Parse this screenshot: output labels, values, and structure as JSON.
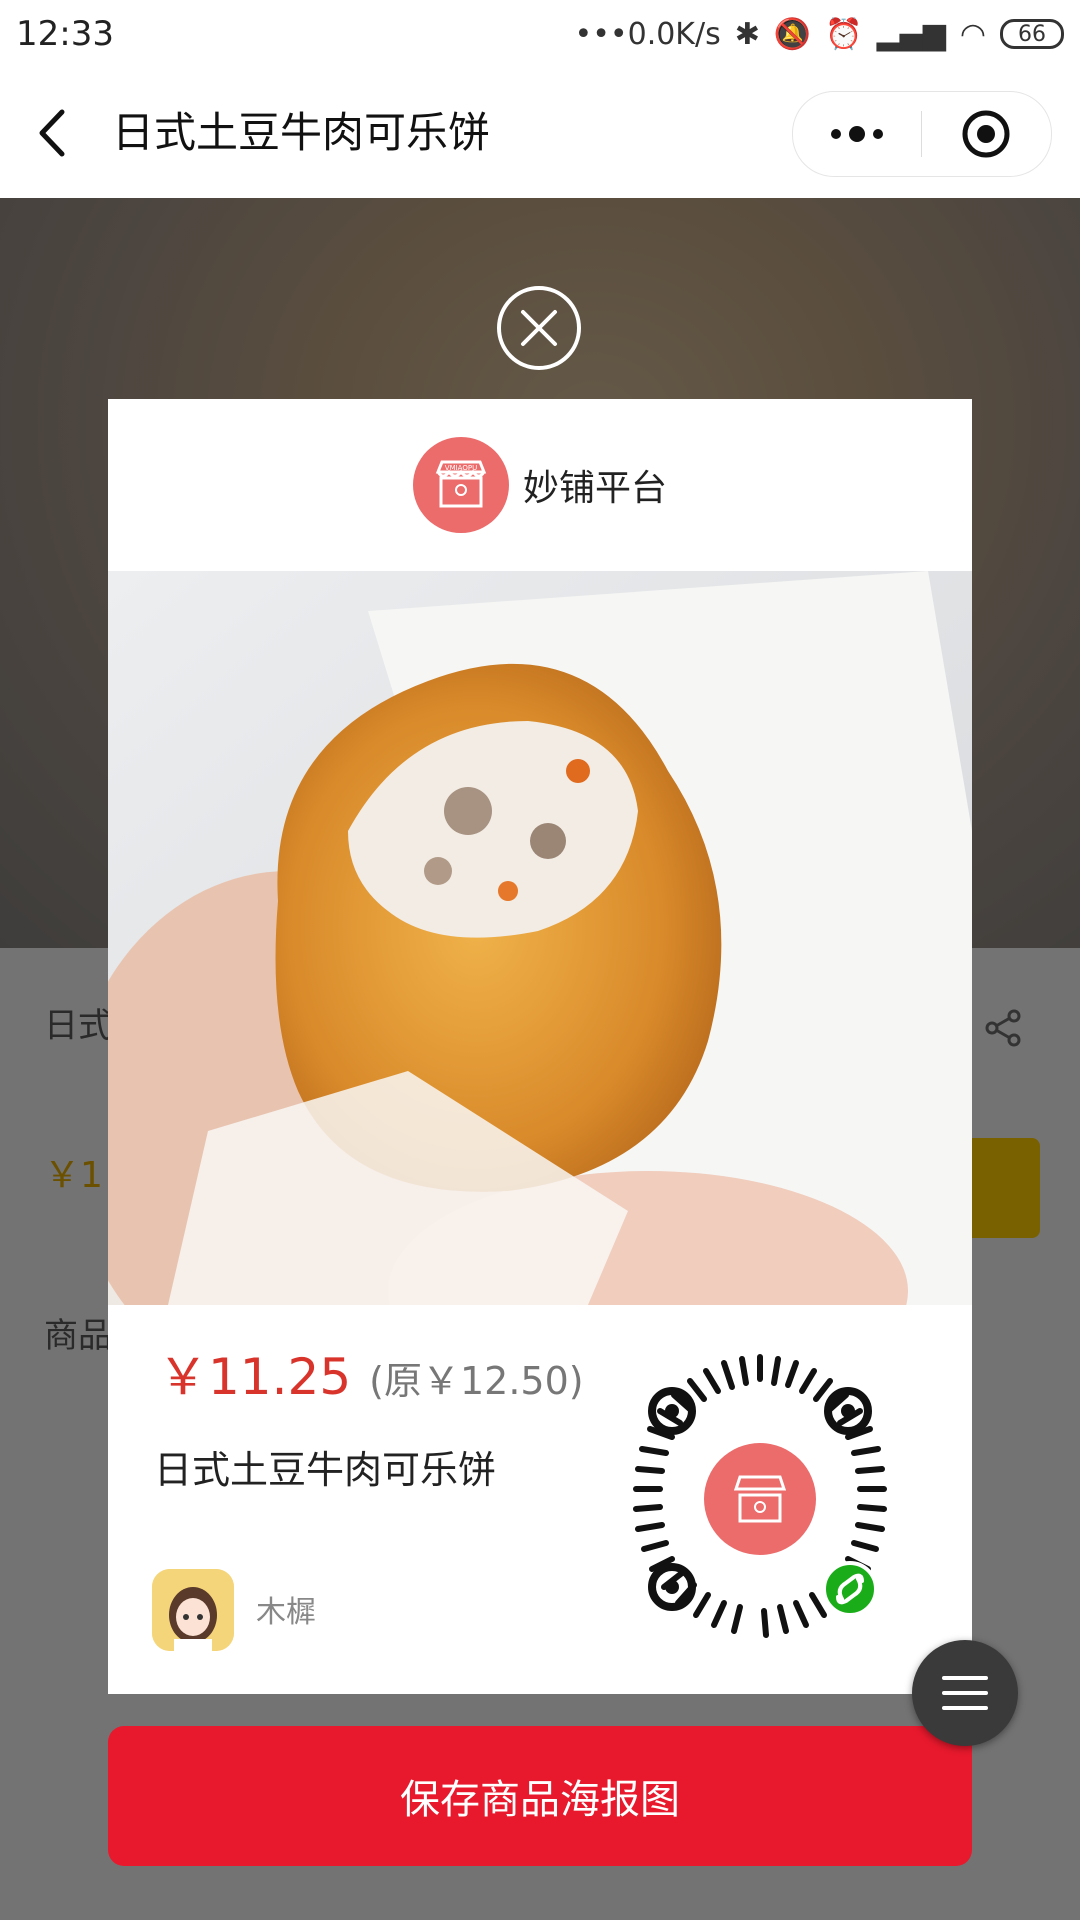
{
  "status_bar": {
    "time": "12:33",
    "network_speed": "•••0.0K/s",
    "battery": "66"
  },
  "nav": {
    "title": "日式土豆牛肉可乐饼"
  },
  "background": {
    "product_title_partial": "日式",
    "price_partial": "￥1",
    "section_partial": "商品"
  },
  "poster": {
    "brand_name": "妙铺平台",
    "logo_text": "VMIAOPU",
    "price_now": "￥11.25",
    "price_original": "(原￥12.50)",
    "product_name": "日式土豆牛肉可乐饼",
    "user_name": "木樨"
  },
  "actions": {
    "save_label": "保存商品海报图"
  },
  "colors": {
    "accent_red": "#e8192d",
    "price_red": "#d9342b",
    "logo_pink": "#ec6b6b",
    "mini_program_green": "#1aad19"
  }
}
